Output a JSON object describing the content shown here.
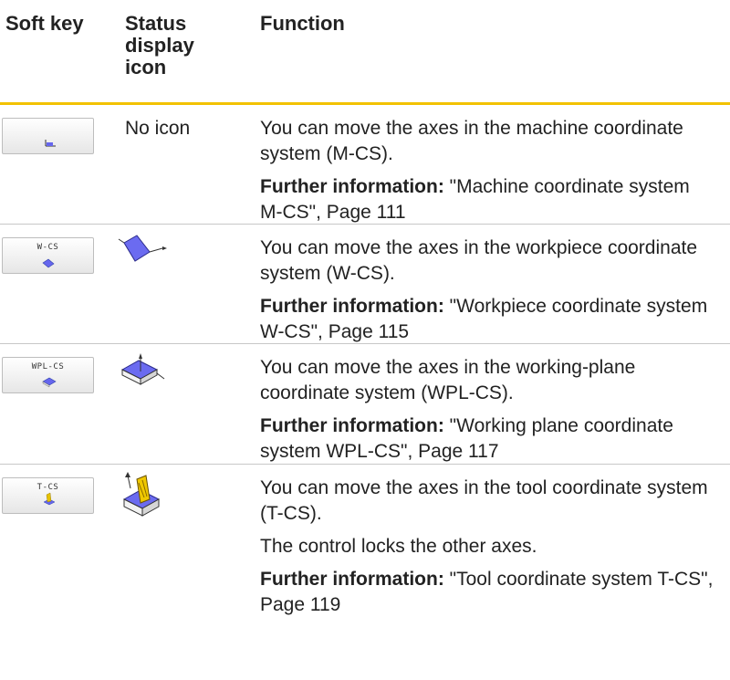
{
  "header": {
    "soft_key": "Soft key",
    "status_display_icon": "Status display icon",
    "function": "Function"
  },
  "rows": [
    {
      "softkey_label": "",
      "status": "No icon",
      "text": "You can move the axes in the machine coordinate system (M-CS).",
      "info_label": "Further information:",
      "info_ref": "\"Machine coordinate system M-CS\", Page 111"
    },
    {
      "softkey_label": "W-CS",
      "status": "",
      "text": "You can move the axes in the workpiece coordinate system (W-CS).",
      "info_label": "Further information:",
      "info_ref": "\"Workpiece coordinate system W-CS\", Page 115"
    },
    {
      "softkey_label": "WPL-CS",
      "status": "",
      "text": "You can move the axes in the working-plane coordinate system (WPL-CS).",
      "info_label": "Further information:",
      "info_ref": "\"Working plane coordinate system WPL-CS\", Page 117"
    },
    {
      "softkey_label": "T-CS",
      "status": "",
      "text": "You can move the axes in the tool coordinate system (T-CS).",
      "text2": "The control locks the other axes.",
      "info_label": "Further information:",
      "info_ref": "\"Tool coordinate system T-CS\", Page 119"
    }
  ],
  "colors": {
    "header_rule": "#f2c200",
    "row_rule": "#c8c8c8",
    "icon_fill": "#6666ee"
  }
}
